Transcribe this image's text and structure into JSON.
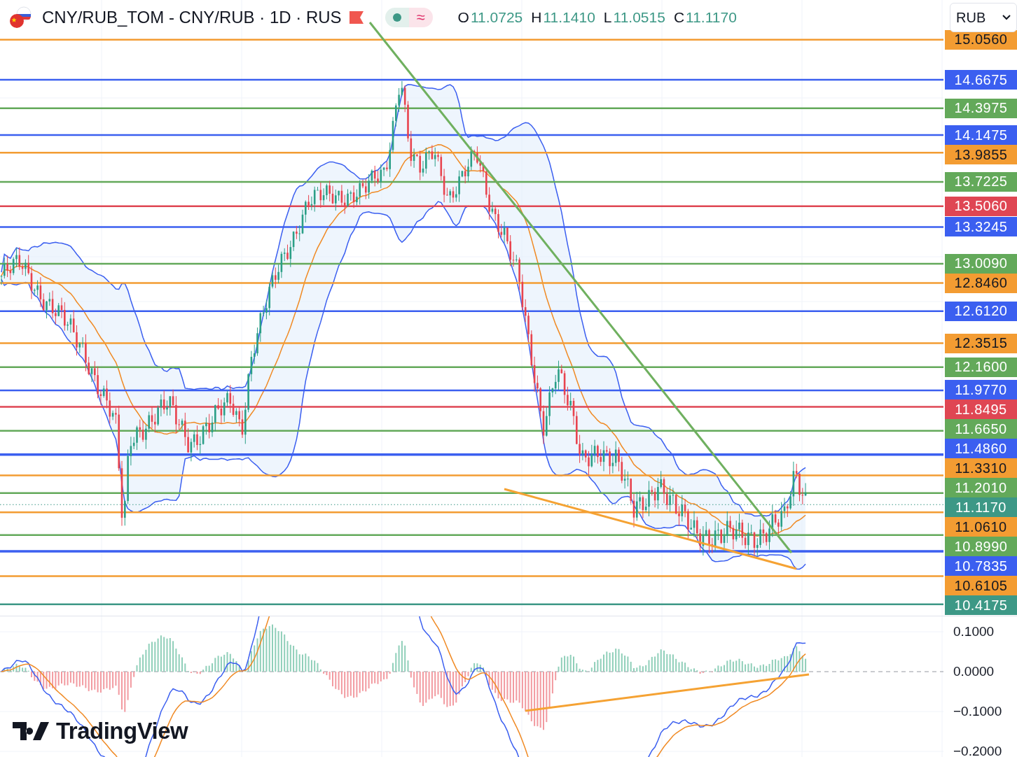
{
  "legend": {
    "title": "CNY/RUB_TOM - CNY/RUB · 1D · RUS",
    "status_symbol": "≈",
    "ohlc": [
      {
        "key": "O",
        "value": "11.0725"
      },
      {
        "key": "H",
        "value": "11.1410"
      },
      {
        "key": "L",
        "value": "11.0515"
      },
      {
        "key": "C",
        "value": "11.1170"
      }
    ]
  },
  "currency_select": {
    "value": "RUB"
  },
  "levels": [
    {
      "label": "15.0560",
      "color": "#f39c32",
      "kind": "level"
    },
    {
      "label": "14.6675",
      "color": "#3b5ff0",
      "kind": "level"
    },
    {
      "label": "14.3975",
      "color": "#63a95a",
      "kind": "level"
    },
    {
      "label": "14.1475",
      "color": "#3b5ff0",
      "kind": "level"
    },
    {
      "label": "13.9855",
      "color": "#f39c32",
      "kind": "level"
    },
    {
      "label": "13.7225",
      "color": "#63a95a",
      "kind": "level"
    },
    {
      "label": "13.5060",
      "color": "#df4653",
      "kind": "level"
    },
    {
      "label": "13.3245",
      "color": "#3b5ff0",
      "kind": "level"
    },
    {
      "label": "13.0090",
      "color": "#63a95a",
      "kind": "level"
    },
    {
      "label": "12.8460",
      "color": "#f39c32",
      "kind": "level"
    },
    {
      "label": "12.6120",
      "color": "#3b5ff0",
      "kind": "level"
    },
    {
      "label": "12.3515",
      "color": "#f39c32",
      "kind": "level"
    },
    {
      "label": "12.1600",
      "color": "#63a95a",
      "kind": "level"
    },
    {
      "label": "11.9770",
      "color": "#3b5ff0",
      "kind": "level"
    },
    {
      "label": "11.8495",
      "color": "#df4653",
      "kind": "level"
    },
    {
      "label": "11.6650",
      "color": "#63a95a",
      "kind": "level"
    },
    {
      "label": "11.4860",
      "color": "#3b5ff0",
      "kind": "level"
    },
    {
      "label": "11.3310",
      "color": "#f39c32",
      "kind": "level"
    },
    {
      "label": "11.2010",
      "color": "#63a95a",
      "kind": "level"
    },
    {
      "label": "11.1170",
      "color": "#3d9886",
      "kind": "last_price"
    },
    {
      "label": "11.0610",
      "color": "#f39c32",
      "kind": "level"
    },
    {
      "label": "10.8990",
      "color": "#63a95a",
      "kind": "level"
    },
    {
      "label": "10.7835",
      "color": "#3b5ff0",
      "kind": "level"
    },
    {
      "label": "10.6105",
      "color": "#f39c32",
      "kind": "level"
    },
    {
      "label": "10.4175",
      "color": "#3d9886",
      "kind": "level"
    }
  ],
  "oscillator": {
    "axis_labels": [
      "0.1000",
      "0.0000",
      "−0.1000",
      "−0.2000"
    ]
  },
  "logo": {
    "text": "TradingView"
  }
}
